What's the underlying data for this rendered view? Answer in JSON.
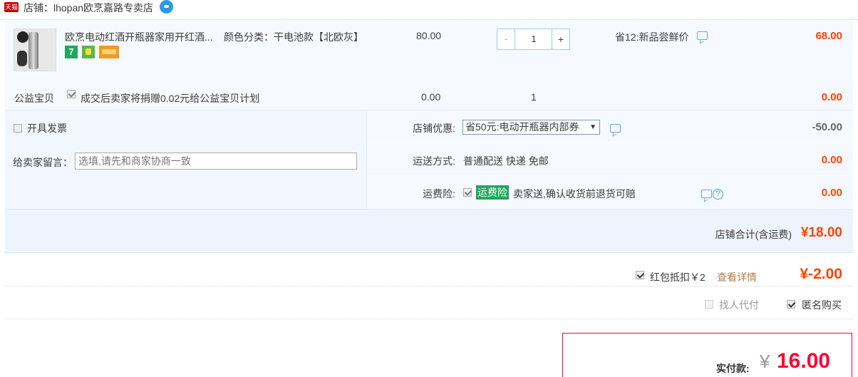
{
  "shop": {
    "badge": "天猫",
    "label": "店铺：lhopan欧烹嘉路专卖店"
  },
  "item": {
    "title": "欧烹电动红酒开瓶器家用开红酒...",
    "sku": "颜色分类：干电池款【北欧灰】",
    "service_icon_1": "7",
    "unit_price": "80.00",
    "qty_minus": "-",
    "qty_value": "1",
    "qty_plus": "+",
    "promo": "省12:新品尝鲜价",
    "total": "68.00"
  },
  "charity": {
    "label": "公益宝贝",
    "text": "成交后卖家将捐赠0.02元给公益宝贝计划",
    "price": "0.00",
    "qty": "1",
    "total": "0.00"
  },
  "invoice": {
    "label": "开具发票"
  },
  "message": {
    "label": "给卖家留言：",
    "placeholder": "选填,请先和商家协商一致"
  },
  "discount": {
    "label": "店铺优惠:",
    "selected": "省50元:电动开瓶器内部券",
    "value": "-50.00"
  },
  "shipping": {
    "label": "运送方式:",
    "text": "普通配送 快递 免邮",
    "value": "0.00"
  },
  "insurance": {
    "label": "运费险:",
    "badge": "运费险",
    "text": "卖家送,确认收货前退货可赔",
    "help": "?",
    "value": "0.00"
  },
  "subtotal": {
    "label": "店铺合计(含运费)",
    "value": "¥18.00"
  },
  "redbag": {
    "text": "红包抵扣￥2",
    "link": "查看详情",
    "value": "¥-2.00"
  },
  "options": {
    "proxy_pay": "找人代付",
    "anonymous": "匿名购买"
  },
  "payment": {
    "label": "实付款:",
    "yen": "¥",
    "amount": "16.00"
  },
  "colors": {
    "accent_red": "#ff4400",
    "pay_red": "#ff0036",
    "tmall_red": "#c40000",
    "link_brown": "#b0814b",
    "insurance_green": "#1ea85a",
    "panel_blue": "#f2f7ff"
  }
}
